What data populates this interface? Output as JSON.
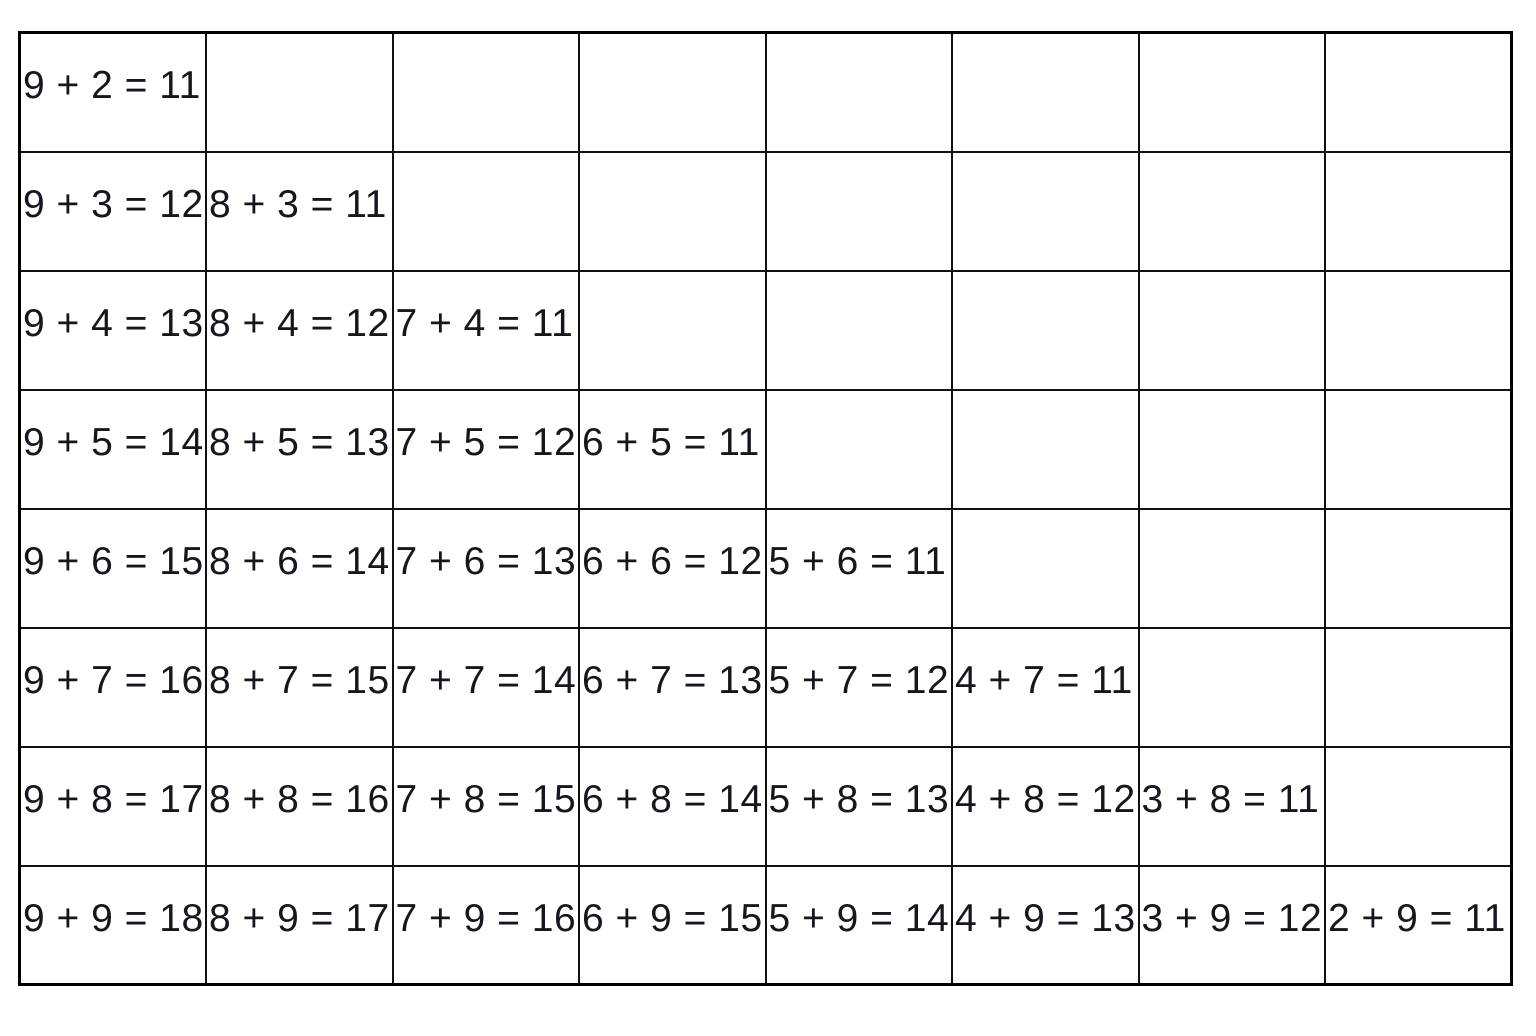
{
  "page": {
    "background_color": "#ffffff",
    "grid_line_color": "#111111",
    "outer_border_color": "#000000",
    "text_color": "#16161e"
  },
  "table": {
    "name": "addition-facts-grid",
    "columns": 8,
    "rows": 8,
    "empty_cell": ""
  },
  "chart_data": {
    "type": "table",
    "title": "",
    "columns": 8,
    "rows": 8,
    "description": "Triangular grid of addition facts with sums from 11 to 18",
    "cells": [
      [
        "9 + 2 = 11",
        "",
        "",
        "",
        "",
        "",
        "",
        ""
      ],
      [
        "9 + 3 = 12",
        "8 + 3 = 11",
        "",
        "",
        "",
        "",
        "",
        ""
      ],
      [
        "9 + 4 = 13",
        "8 + 4 = 12",
        "7 + 4 = 11",
        "",
        "",
        "",
        "",
        ""
      ],
      [
        "9 + 5 = 14",
        "8 + 5 = 13",
        "7 + 5 = 12",
        "6 + 5 = 11",
        "",
        "",
        "",
        ""
      ],
      [
        "9 + 6 = 15",
        "8 + 6 = 14",
        "7 + 6 = 13",
        "6 + 6 = 12",
        "5 + 6 = 11",
        "",
        "",
        ""
      ],
      [
        "9 + 7 = 16",
        "8 + 7 = 15",
        "7 + 7 = 14",
        "6 + 7 = 13",
        "5 + 7 = 12",
        "4 + 7 = 11",
        "",
        ""
      ],
      [
        "9 + 8 = 17",
        "8 + 8 = 16",
        "7 + 8 = 15",
        "6 + 8 = 14",
        "5 + 8 = 13",
        "4 + 8 = 12",
        "3 + 8 = 11",
        ""
      ],
      [
        "9 + 9 = 18",
        "8 + 9 = 17",
        "7 + 9 = 16",
        "6 + 9 = 15",
        "5 + 9 = 14",
        "4 + 9 = 13",
        "3 + 9 = 12",
        "2 + 9 = 11"
      ]
    ]
  },
  "footer": {
    "caption": ""
  }
}
